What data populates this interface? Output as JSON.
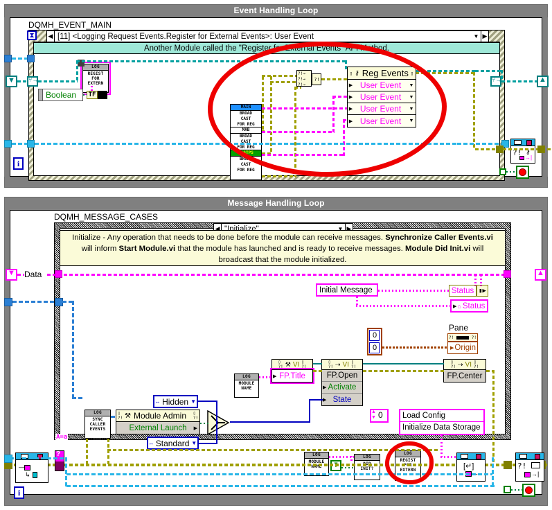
{
  "event_loop": {
    "title": "Event Handling Loop",
    "diagram_label": "DQMH_EVENT_MAIN",
    "case_selector": "[11] <Logging Request Events.Register for External Events>: User Event",
    "banner_text": "Another Module called the \"Register for External Events\" API Method.",
    "boolean_terminal": "Boolean",
    "boolean_tf": "TF",
    "register_vi": {
      "header": "LOG",
      "line1": "REGIST",
      "line2": "FOR",
      "line3": "EXTERN"
    },
    "broadcasts": [
      {
        "name": "MAIN",
        "header_color": "#1e90ff",
        "line1": "BROAD",
        "line2": "CAST",
        "line3": "FOR REG"
      },
      {
        "name": "MAB",
        "header_color": "#ffffff",
        "line1": "BROAD",
        "line2": "CAST",
        "line3": "FOR REG"
      },
      {
        "name": "FASTPS",
        "header_color": "#00a000",
        "line1": "BROAD",
        "line2": "CAST",
        "line3": "FOR REG"
      }
    ],
    "reg_events": {
      "title": "Reg Events",
      "rows": [
        "User Event",
        "User Event",
        "User Event",
        "User Event"
      ]
    },
    "iteration_terminal": "i"
  },
  "message_loop": {
    "title": "Message Handling Loop",
    "diagram_label": "DQMH_MESSAGE_CASES",
    "case_selector": "\"Initialize\"",
    "doc_line1_a": "Initialize - Any operation that needs to be done before the module can receive messages. ",
    "doc_line1_b": "Synchronize Caller Events.vi",
    "doc_line2_a": "will inform ",
    "doc_line2_b": "Start Module.vi",
    "doc_line2_c": " that the module has launched and is ready to receive messages. ",
    "doc_line2_d": "Module Did Init.vi",
    "doc_line2_e": " will",
    "doc_line3": "broadcast that the module initialized.",
    "data_label": "Data",
    "initial_message_const": "Initial Message",
    "status_indicator": "Status",
    "status_property": "Status",
    "pane_label": "Pane",
    "origin_property": "Origin",
    "origin_x": "0",
    "origin_y": "0",
    "fp_title_const": "FP.Title",
    "fp_open_node": "FP.Open",
    "fp_open_activate": "Activate",
    "fp_open_state": "State",
    "fp_center_node": "FP.Center",
    "vi_hdr": "VI",
    "module_admin": {
      "header": "Module Admin",
      "method": "External Launch"
    },
    "enum_hidden": "Hidden",
    "enum_standard": "Standard",
    "index_const": "0",
    "config_list": [
      "Load Config",
      "Initialize Data Storage"
    ],
    "sync_caller_vi": {
      "header": "LOG",
      "line1": "SYNC",
      "line2": "CALLER",
      "line3": "EVENTS"
    },
    "module_name_vi_1": {
      "header": "LOG",
      "line1": "MODULE",
      "line2": "NAME"
    },
    "module_name_vi_2": {
      "header": "LOG",
      "line1": "MODULE",
      "line2": "NAME"
    },
    "did_init_vi": {
      "header": "LOG",
      "line1": "DID",
      "line2": "INIT?"
    },
    "register_extern_vi": {
      "header": "LOG",
      "line1": "REGIST",
      "line2": "FOR",
      "line3": "EXTERN"
    },
    "true_const": "T",
    "iteration_terminal": "i",
    "aa_label": "A=a"
  },
  "colors": {
    "loop_frame": "#808080",
    "title_text": "#ffffff",
    "banner_teal": "#9fe8d8",
    "doc_yellow": "#fbfbd8",
    "wire_pink": "#ff00ff",
    "wire_teal": "#00a0a0",
    "wire_olive": "#a0a000",
    "wire_blue": "#0000c0",
    "wire_chain_blue": "#29b6e8",
    "wire_brown": "#a04000",
    "annotation_red": "#ee0000"
  }
}
